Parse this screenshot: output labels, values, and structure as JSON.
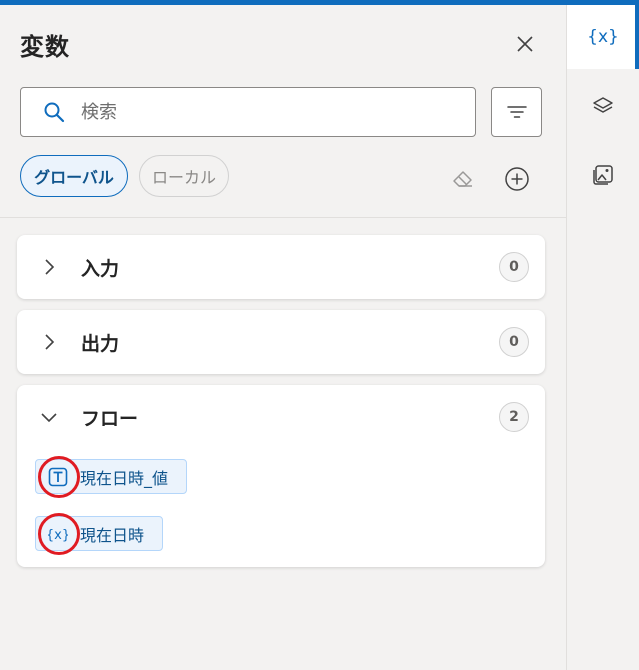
{
  "panel": {
    "title": "変数",
    "search": {
      "placeholder": "検索",
      "value": ""
    },
    "scope_tabs": [
      {
        "label": "グローバル",
        "selected": true
      },
      {
        "label": "ローカル",
        "selected": false
      }
    ],
    "sections": [
      {
        "label": "入力",
        "count": "0",
        "expanded": false,
        "variables": []
      },
      {
        "label": "出力",
        "count": "0",
        "expanded": false,
        "variables": []
      },
      {
        "label": "フロー",
        "count": "2",
        "expanded": true,
        "variables": [
          {
            "name": "現在日時_値",
            "type_icon": "text-type-icon"
          },
          {
            "name": "現在日時",
            "type_icon": "variable-type-icon"
          }
        ]
      }
    ]
  },
  "side_rail": {
    "items": [
      {
        "icon": "variables-icon",
        "text": "{x}",
        "active": true
      },
      {
        "icon": "layers-icon",
        "active": false
      },
      {
        "icon": "images-icon",
        "active": false
      }
    ]
  },
  "colors": {
    "accent": "#0f6cbd",
    "highlight_ring": "#e01b22",
    "panel_bg": "#f3f2f1",
    "chip_bg": "#ebf3fc"
  }
}
